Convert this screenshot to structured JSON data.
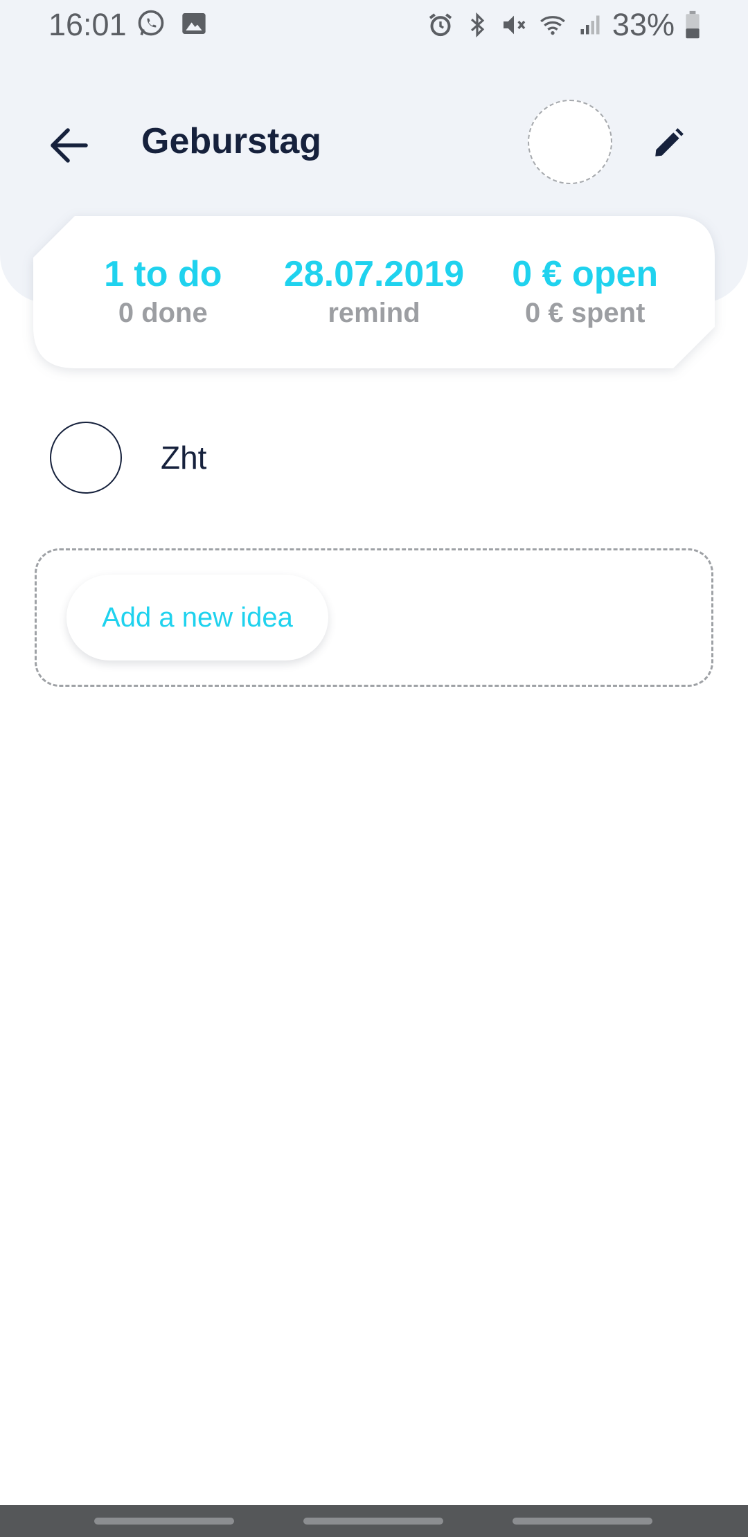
{
  "status_bar": {
    "time": "16:01",
    "battery": "33%",
    "left_icons": [
      "whatsapp-icon",
      "image-icon"
    ],
    "right_icons": [
      "alarm-icon",
      "bluetooth-icon",
      "mute-icon",
      "wifi-icon",
      "signal-icon",
      "battery-icon"
    ]
  },
  "toolbar": {
    "title": "Geburstag",
    "back_icon": "arrow-left-icon",
    "edit_icon": "pencil-icon"
  },
  "summary": {
    "todo": {
      "value": "1 to do",
      "sub": "0 done"
    },
    "remind": {
      "value": "28.07.2019",
      "sub": "remind"
    },
    "money": {
      "value": "0 € open",
      "sub": "0 € spent"
    }
  },
  "ideas": [
    {
      "label": "Zht",
      "done": false
    }
  ],
  "add_idea": {
    "label": "Add a new idea"
  },
  "colors": {
    "accent": "#1fd2ee",
    "dark": "#16213c",
    "muted": "#9c9ea2",
    "header_bg": "#f0f3f8"
  }
}
